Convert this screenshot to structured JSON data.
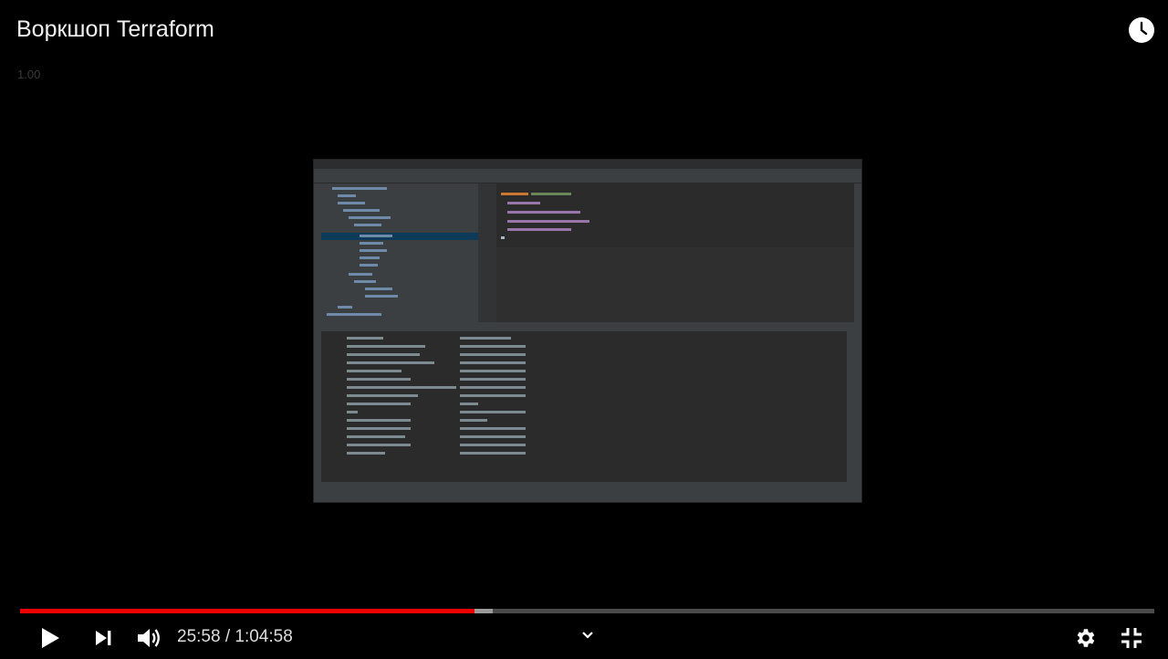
{
  "video": {
    "title": "Воркшоп Terraform",
    "speed": "1.00",
    "progress_fraction": 0.401,
    "buffered_fraction": 0.417
  },
  "controls": {
    "current_time": "25:58",
    "separator": " / ",
    "duration": "1:04:58"
  },
  "icons": {
    "watch_later": "clock-icon",
    "play": "play-icon",
    "next": "next-icon",
    "volume": "volume-icon",
    "chapters": "chevron-down-icon",
    "settings": "gear-icon",
    "exit_fullscreen": "exit-fullscreen-icon"
  },
  "colors": {
    "played": "#e00000",
    "background": "#000000"
  }
}
